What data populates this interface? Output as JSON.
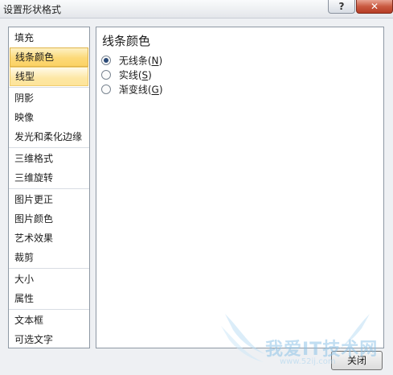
{
  "window": {
    "title": "设置形状格式",
    "help_label": "?",
    "close_glyph": "✕"
  },
  "nav": {
    "groups": [
      [
        "填充",
        "线条颜色",
        "线型"
      ],
      [
        "阴影",
        "映像",
        "发光和柔化边缘"
      ],
      [
        "三维格式",
        "三维旋转"
      ],
      [
        "图片更正",
        "图片颜色",
        "艺术效果",
        "裁剪"
      ],
      [
        "大小",
        "属性"
      ],
      [
        "文本框",
        "可选文字"
      ]
    ],
    "selected": "线条颜色"
  },
  "panel": {
    "title": "线条颜色",
    "options": [
      {
        "label": "无线条",
        "key": "N",
        "checked": true
      },
      {
        "label": "实线",
        "key": "S",
        "checked": false
      },
      {
        "label": "渐变线",
        "key": "G",
        "checked": false
      }
    ]
  },
  "footer": {
    "close_label": "关闭"
  },
  "watermark": {
    "text": "我爱IT技术网",
    "sub": "www.52ij.com"
  }
}
